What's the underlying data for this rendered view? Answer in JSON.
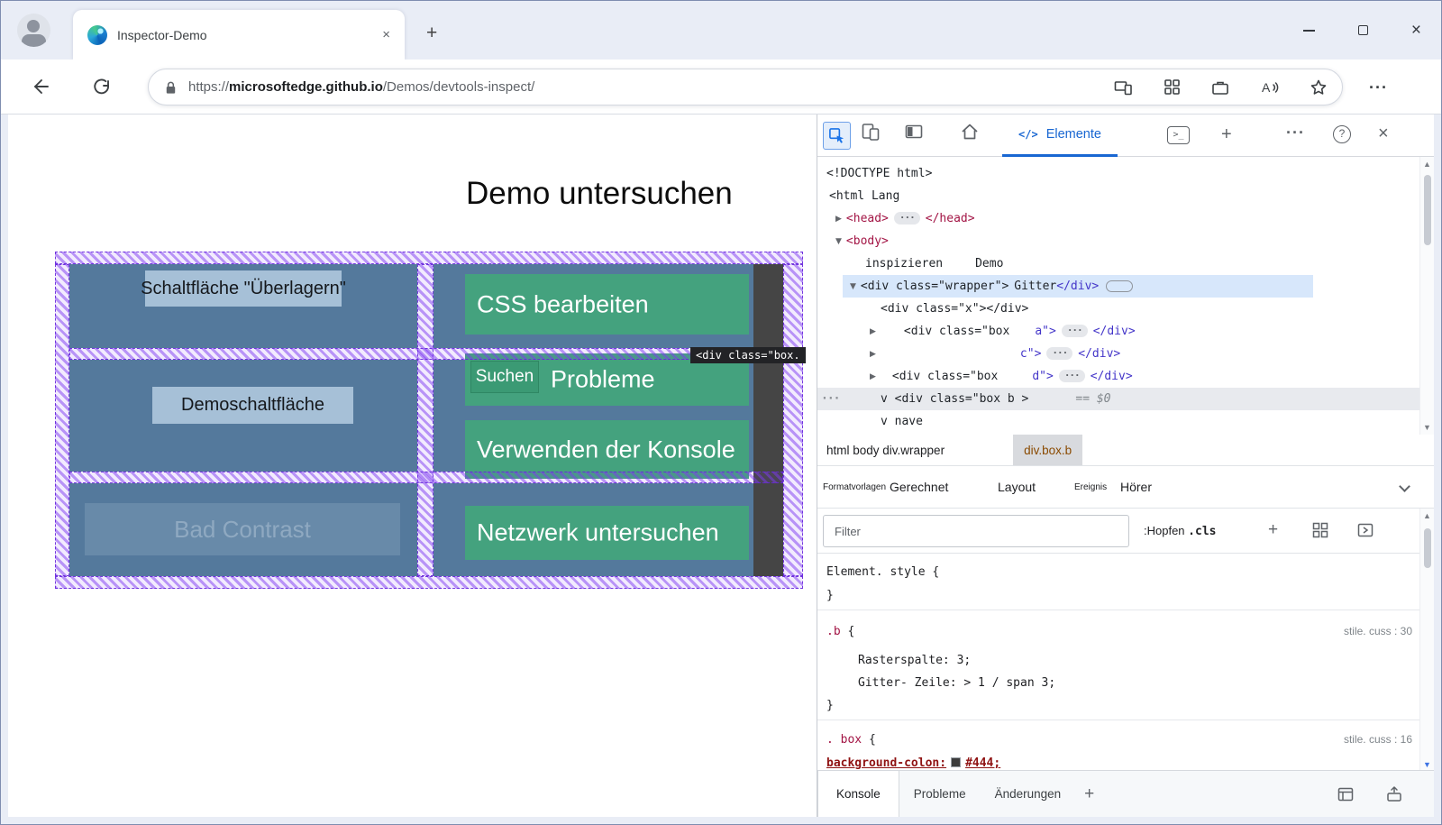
{
  "colors": {
    "grid_overlay_purple": "#7e3af0",
    "cell_blue": "#54799c",
    "box_green": "#44a27e",
    "dark_bar": "#454545",
    "accent_blue": "#1967d2"
  },
  "icons": {
    "more": "···",
    "dots_badge": "···",
    "gutter": "···",
    "close": "×",
    "plus": "+",
    "help": "?",
    "console": ">_",
    "code": "</>",
    "tree_expand": "▶",
    "tree_collapse": "▼",
    "scroll_up": "▲",
    "scroll_down": "▼"
  },
  "chrome": {
    "tab_title": "Inspector-Demo",
    "url_scheme": "https://",
    "url_host": "microsoftedge.github.io",
    "url_path": "/Demos/devtools-inspect/"
  },
  "page": {
    "title": "Demo untersuchen",
    "overlay_button": "Schaltfläche \"Überlagern\"",
    "demo_button": "Demoschaltfläche",
    "bad_contrast_button": "Bad Contrast",
    "edit_css_box": "CSS bearbeiten",
    "search_label": "Suchen",
    "issues_label": "Probleme",
    "console_box": "Verwenden der Konsole",
    "network_box": "Netzwerk untersuchen",
    "grid_tooltip": "<div class=\"box."
  },
  "devtools": {
    "elements_tab": "Elemente",
    "dom": {
      "doctype": "<!DOCTYPE html>",
      "html_open": "<html Lang",
      "head_open": "<head>",
      "head_close": "</head>",
      "body_open": "<body>",
      "text_a": "inspizieren",
      "text_b": "Demo",
      "wrapper_open": "<div class=\"wrapper\">",
      "wrapper_badge": "Gitter",
      "close_div": "</div>",
      "x_line": "<div class=\"x\"></div>",
      "box_open": "<div class=\"box",
      "a_attr": "a\">",
      "c_attr": "c\">",
      "d_attr": "d\">",
      "selected_line": "v <div class=\"box b >",
      "selected_hint": "== $0",
      "nav_line": "v nave"
    },
    "breadcrumb": {
      "path": "html body div.wrapper",
      "selected": "div.box.b"
    },
    "tabs": {
      "styles": "Formatvorlagen",
      "computed": "Gerechnet",
      "layout": "Layout",
      "events_a": "Ereignis",
      "events_b": "Hörer"
    },
    "filter": {
      "placeholder": "Filter",
      "hov": ":Hopfen",
      "cls": ".cls"
    },
    "styles": {
      "element_style": "Element. style {",
      "close_brace": "}",
      "b_selector": ".b",
      "brace_open": " {",
      "b_source": "stile. cuss : 30",
      "b_prop1": "Rasterspalte: 3;",
      "b_prop2": "Gitter- Zeile: > 1 / span 3;",
      "box_selector": ". box",
      "box_source": "stile. cuss : 16",
      "bg_prop": "background-colon:",
      "bg_value": "#444;"
    },
    "drawer": {
      "console": "Konsole",
      "issues": "Probleme",
      "changes": "Änderungen"
    }
  }
}
